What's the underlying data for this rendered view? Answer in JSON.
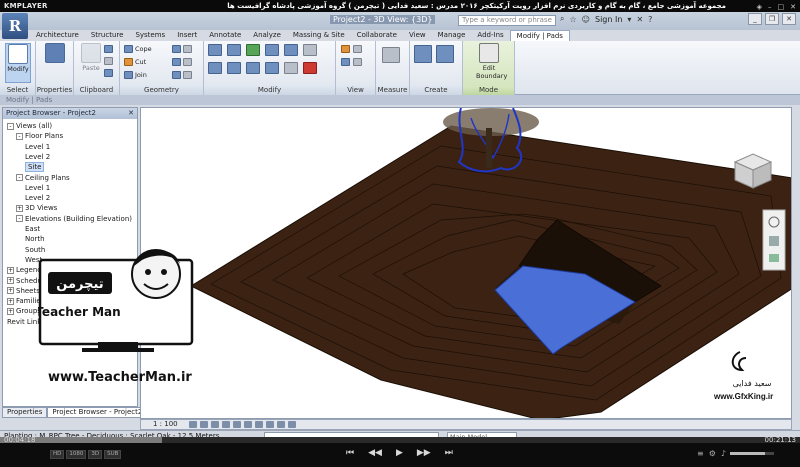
{
  "player": {
    "logo": "KMPLAYER",
    "title": "مجموعه آموزشی جامع ، گام به گام و کاربردی نرم افزار رویت آرکیتکچر ۲۰۱۶  مدرس : سعید فدایی ( تیچرمن ) گروه آموزشی پادشاه گرافیست ها",
    "time_current": "00:04:18",
    "time_total": "00:21:13",
    "progress": 0.203,
    "volume": 0.8,
    "tags": [
      "HD",
      "1080",
      "3D",
      "SUB"
    ],
    "controls": [
      "⏮",
      "◀◀",
      "▶",
      "▶▶",
      "⏭"
    ]
  },
  "revit": {
    "app_letter": "R",
    "doc_title": "Project2 - 3D View: {3D}",
    "search_placeholder": "Type a keyword or phrase",
    "sign_in": "Sign In",
    "tabs": [
      "Architecture",
      "Structure",
      "Systems",
      "Insert",
      "Annotate",
      "Analyze",
      "Massing & Site",
      "Collaborate",
      "View",
      "Manage",
      "Add-Ins",
      "Modify | Pads"
    ],
    "active_tab": "Modify | Pads",
    "ribbon": {
      "modify_label": "Modify",
      "properties_label": "Properties",
      "paste_label": "Paste",
      "cope_label": "Cope",
      "cut_label": "Cut",
      "join_label": "Join",
      "edit_boundary_label": "Edit Boundary",
      "panels": {
        "select": "Select",
        "properties": "Properties",
        "clipboard": "Clipboard",
        "geometry": "Geometry",
        "modify": "Modify",
        "view": "View",
        "measure": "Measure",
        "create": "Create",
        "mode": "Mode"
      }
    },
    "context_label": "Modify | Pads",
    "browser": {
      "title": "Project Browser - Project2",
      "tree": [
        {
          "label": "Views (all)",
          "level": 0,
          "exp": "-"
        },
        {
          "label": "Floor Plans",
          "level": 1,
          "exp": "-"
        },
        {
          "label": "Level 1",
          "level": 2
        },
        {
          "label": "Level 2",
          "level": 2
        },
        {
          "label": "Site",
          "level": 2,
          "selected": true
        },
        {
          "label": "Ceiling Plans",
          "level": 1,
          "exp": "-"
        },
        {
          "label": "Level 1",
          "level": 2
        },
        {
          "label": "Level 2",
          "level": 2
        },
        {
          "label": "3D Views",
          "level": 1,
          "exp": "+"
        },
        {
          "label": "Elevations (Building Elevation)",
          "level": 1,
          "exp": "-"
        },
        {
          "label": "East",
          "level": 2
        },
        {
          "label": "North",
          "level": 2
        },
        {
          "label": "South",
          "level": 2
        },
        {
          "label": "West",
          "level": 2
        },
        {
          "label": "Legends",
          "level": 0,
          "exp": "+"
        },
        {
          "label": "Schedules/Quantities",
          "level": 0,
          "exp": "+"
        },
        {
          "label": "Sheets (all)",
          "level": 0,
          "exp": "+"
        },
        {
          "label": "Families",
          "level": 0,
          "exp": "+"
        },
        {
          "label": "Groups",
          "level": 0,
          "exp": "+"
        },
        {
          "label": "Revit Links",
          "level": 0
        }
      ],
      "tabs": [
        "Properties",
        "Project Browser - Project2"
      ],
      "active_tab": "Project Browser - Project2"
    },
    "view_scale": "1 : 100",
    "status_text": "Planting : M_RPC Tree - Deciduous : Scarlet Oak - 12.5 Meters",
    "model_dropdown": "Main Model"
  },
  "overlay": {
    "teacher_brand": "Teacher Man",
    "teacher_brand_fa": "تیچرمن",
    "teacher_url": "www.TeacherMan.ir",
    "gfx_name_fa": "سعید فدایی",
    "gfx_url": "www.GfxKing.ir"
  },
  "colors": {
    "terrain": "#3b2213",
    "terrain_edge": "#1a0e06",
    "pad_water": "#4a6fd6",
    "pit_wall": "#1b1007",
    "tree_outline": "#1f36c8",
    "ribbon_active": "#d1e3b9"
  }
}
